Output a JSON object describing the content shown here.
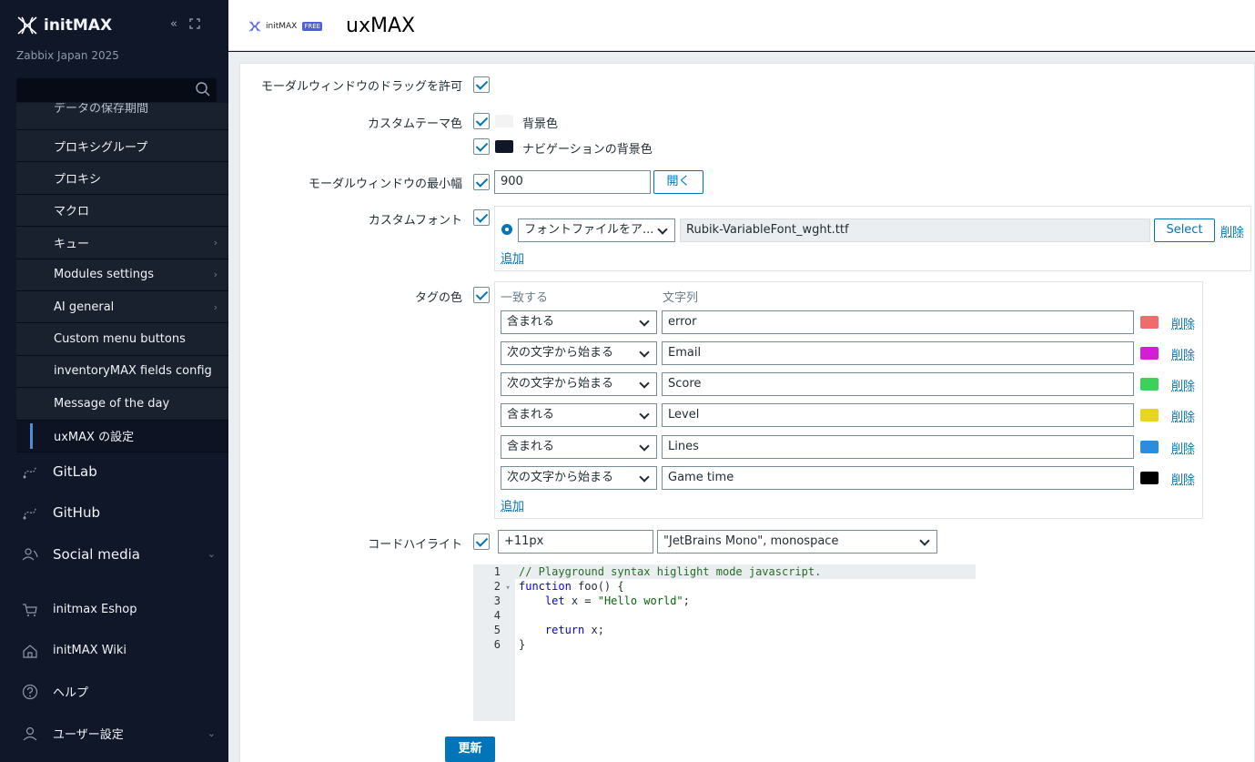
{
  "sidebar": {
    "brand": "initMAX",
    "subtitle": "Zabbix Japan 2025",
    "partial_item": "データの保存期間",
    "items": [
      {
        "label": "プロキシグループ",
        "chev": false
      },
      {
        "label": "プロキシ",
        "chev": false
      },
      {
        "label": "マクロ",
        "chev": false
      },
      {
        "label": "キュー",
        "chev": true
      },
      {
        "label": "Modules settings",
        "chev": true
      },
      {
        "label": "AI general",
        "chev": true
      },
      {
        "label": "Custom menu buttons",
        "chev": false
      },
      {
        "label": "inventoryMAX fields config",
        "chev": false
      },
      {
        "label": "Message of the day",
        "chev": false
      },
      {
        "label": "uxMAX の設定",
        "chev": false
      }
    ],
    "nav": [
      {
        "label": "GitLab",
        "icon": "gitlab-route-icon"
      },
      {
        "label": "GitHub",
        "icon": "github-route-icon"
      },
      {
        "label": "Social media",
        "icon": "social-users-icon"
      },
      {
        "label": "initmax Eshop",
        "icon": "cart-icon"
      },
      {
        "label": "initMAX Wiki",
        "icon": "home-icon"
      },
      {
        "label": "ヘルプ",
        "icon": "help-icon"
      },
      {
        "label": "ユーザー設定",
        "icon": "user-icon"
      }
    ]
  },
  "header": {
    "logo_text": "initMAX",
    "badge": "FREE",
    "title": "uxMAX"
  },
  "form": {
    "drag_label": "モーダルウィンドウのドラッグを許可",
    "theme_label": "カスタムテーマ色",
    "bg_color_label": "背景色",
    "bg_color": "#f3f3f3",
    "nav_bg_label": "ナビゲーションの背景色",
    "nav_bg_color": "#0f1729",
    "modal_min_label": "モーダルウィンドウの最小幅",
    "modal_min_value": "900",
    "open_button": "開く",
    "font_label": "カスタムフォント",
    "font_source": "フォントファイルをア...",
    "font_file": "Rubik-VariableFont_wght.ttf",
    "select_button": "Select",
    "remove": "削除",
    "add": "追加",
    "tag_label": "タグの色",
    "tag_col_match": "一致する",
    "tag_col_string": "文字列",
    "tags": [
      {
        "match": "含まれる",
        "value": "error",
        "color": "#f06b6b"
      },
      {
        "match": "次の文字から始まる",
        "value": "Email",
        "color": "#d21fd3"
      },
      {
        "match": "次の文字から始まる",
        "value": "Score",
        "color": "#3ed15a"
      },
      {
        "match": "含まれる",
        "value": "Level",
        "color": "#e8d61e"
      },
      {
        "match": "含まれる",
        "value": "Lines",
        "color": "#2a8de0"
      },
      {
        "match": "次の文字から始まる",
        "value": "Game time",
        "color": "#000000"
      }
    ],
    "code_label": "コードハイライト",
    "code_size": "+11px",
    "code_font": "\"JetBrains Mono\", monospace",
    "code_lines": [
      "// Playground syntax higlight mode javascript.",
      "function foo() {",
      "    let x = \"Hello world\";",
      "",
      "    return x;",
      "}"
    ],
    "submit": "更新"
  }
}
